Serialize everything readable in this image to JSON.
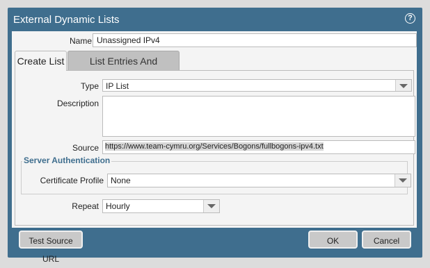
{
  "dialog": {
    "title": "External Dynamic Lists",
    "help_icon": "?"
  },
  "name": {
    "label": "Name",
    "value": "Unassigned IPv4"
  },
  "tabs": [
    {
      "label": "Create List",
      "active": true
    },
    {
      "label": "List Entries And Exceptions",
      "active": false
    }
  ],
  "form": {
    "type_label": "Type",
    "type_value": "IP List",
    "description_label": "Description",
    "description_value": "",
    "source_label": "Source",
    "source_value": "https://www.team-cymru.org/Services/Bogons/fullbogons-ipv4.txt",
    "server_auth_legend": "Server Authentication",
    "cert_profile_label": "Certificate Profile",
    "cert_profile_value": "None",
    "repeat_label": "Repeat",
    "repeat_value": "Hourly"
  },
  "buttons": {
    "test_source": "Test Source URL",
    "ok": "OK",
    "cancel": "Cancel"
  },
  "colors": {
    "header": "#3f6e8e",
    "panel": "#f4f4f4",
    "button": "#c9c9c9"
  }
}
